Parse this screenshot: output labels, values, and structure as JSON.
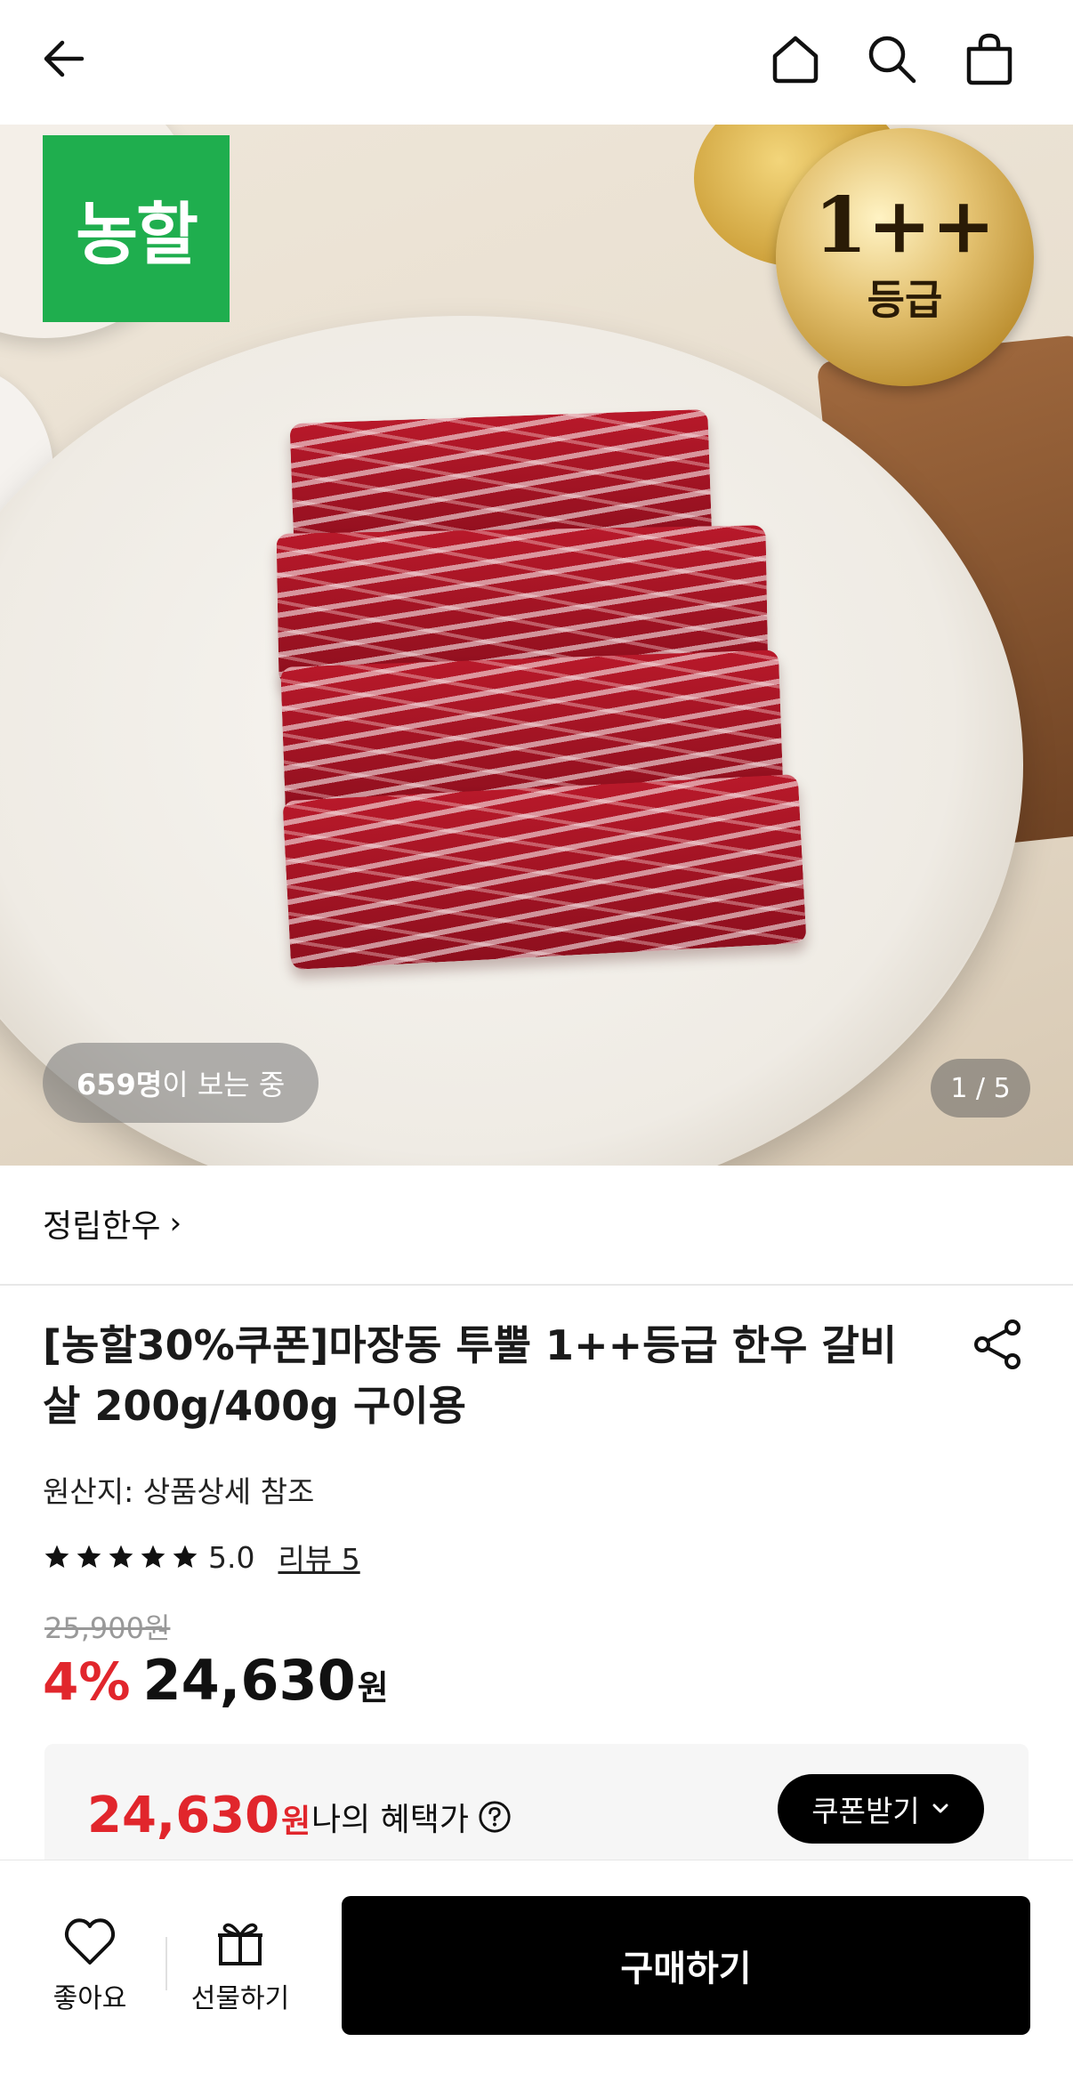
{
  "topbar": {
    "back_icon": "arrow-left-icon",
    "home_icon": "home-icon",
    "search_icon": "search-icon",
    "bag_icon": "shopping-bag-icon"
  },
  "hero": {
    "brand_logo_text": "농할",
    "grade_badge_main": "1++",
    "grade_badge_sub": "등급",
    "viewers_count": "659명",
    "viewers_suffix": "이 보는 중",
    "pager": "1 / 5"
  },
  "store": {
    "name": "정립한우",
    "chevron": "›"
  },
  "product": {
    "title": "[농할30%쿠폰]마장동 투뿔 1++등급 한우 갈비살 200g/400g 구이용",
    "origin": "원산지: 상품상세 참조",
    "rating": "5.0",
    "stars": 5,
    "review_link": "리뷰 5",
    "original_price": "25,900원",
    "discount": "4%",
    "price": "24,630",
    "price_unit": "원"
  },
  "benefit": {
    "price": "24,630",
    "price_unit": "원",
    "label": "나의 혜택가",
    "coupon_button": "쿠폰받기",
    "accent_color": "#e1262c"
  },
  "bottom_bar": {
    "like_label": "좋아요",
    "gift_label": "선물하기",
    "buy_button": "구매하기"
  }
}
